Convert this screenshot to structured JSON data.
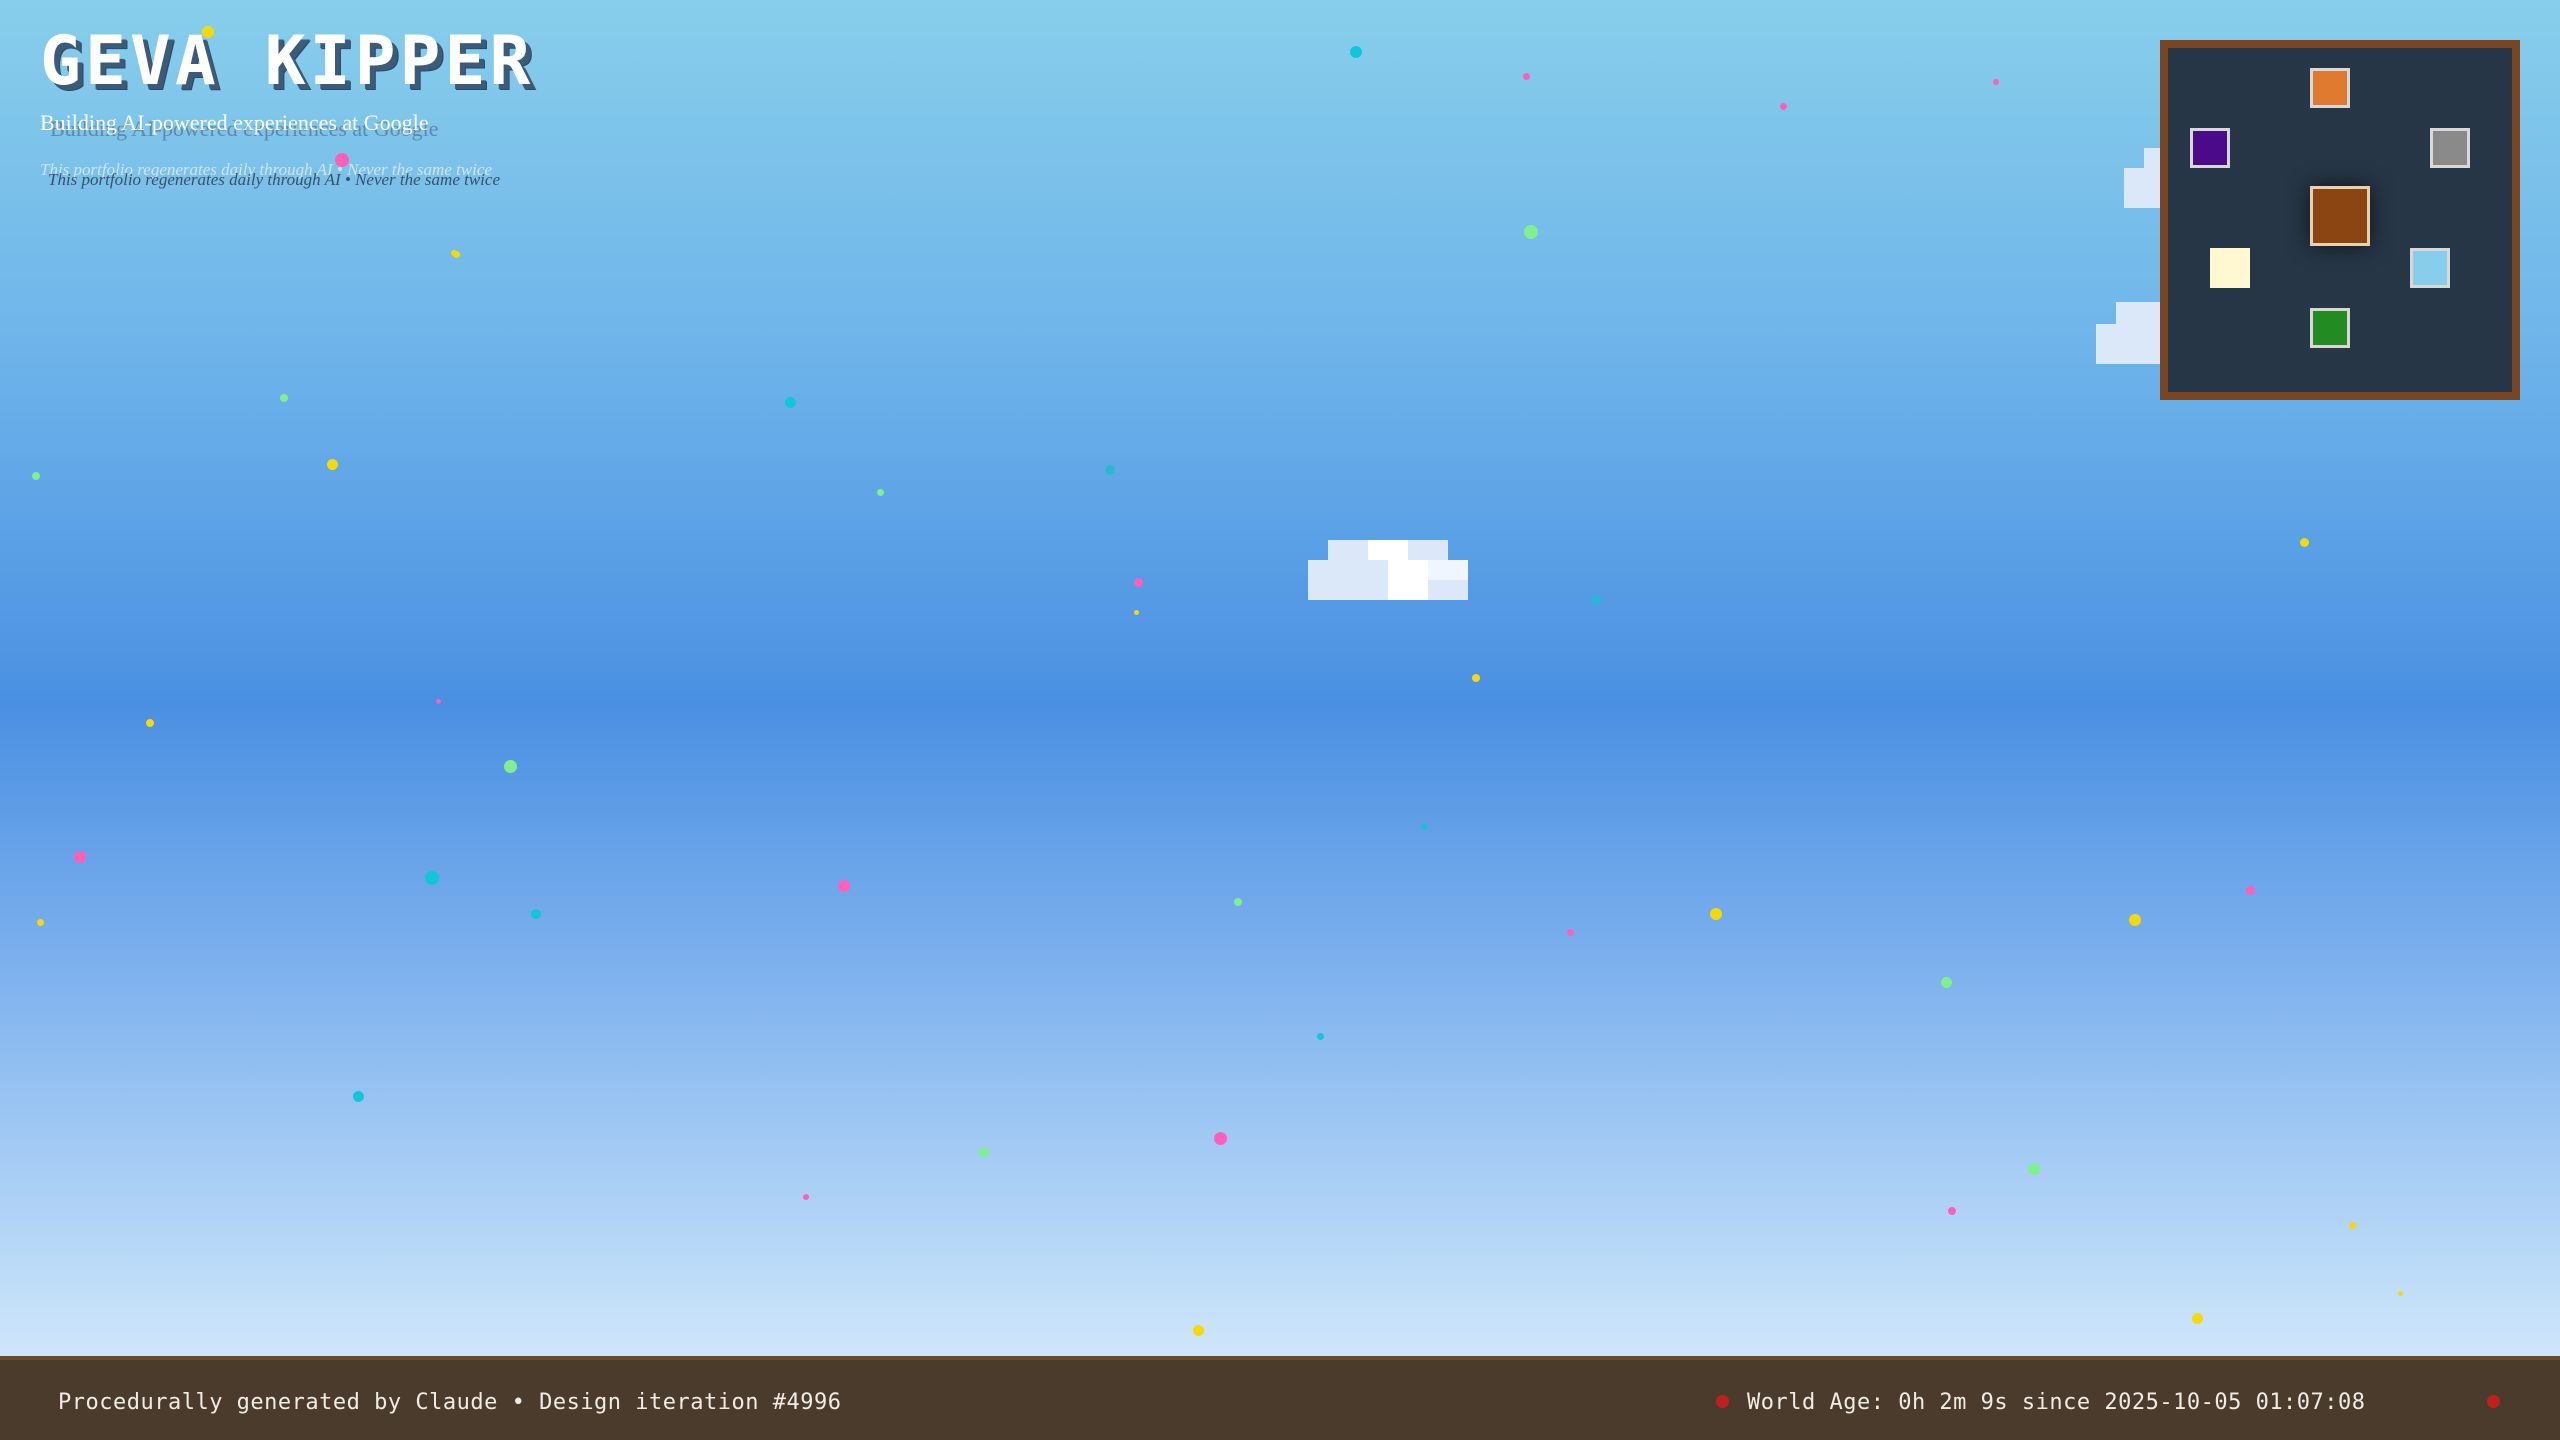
{
  "header": {
    "title": "GEVA KIPPER",
    "subtitle": "Building AI-powered experiences at Google",
    "tagline": "This portfolio regenerates daily through AI • Never the same twice"
  },
  "minimap": {
    "background": "#263646",
    "border": "#7a4522",
    "nodes": [
      {
        "name": "orange",
        "color": "#e07a2e"
      },
      {
        "name": "purple",
        "color": "#4b0a8a"
      },
      {
        "name": "gray",
        "color": "#8a8a8a"
      },
      {
        "name": "brown-center",
        "color": "#8b4513"
      },
      {
        "name": "cream",
        "color": "#fff8d0"
      },
      {
        "name": "light-blue",
        "color": "#87ceeb"
      },
      {
        "name": "green",
        "color": "#228b22"
      }
    ]
  },
  "footer": {
    "left_text": "Procedurally generated by Claude • Design iteration #4996",
    "right_text": "World Age: 0h 2m 9s since 2025-10-05 01:07:08"
  },
  "colors": {
    "sky_top": "#87ceeb",
    "sky_mid": "#4a90e2",
    "sky_bottom": "#cfe6fb",
    "footer_bg": "#4a3b2c",
    "footer_border": "#6b4a2a",
    "indicator": "#c0201d",
    "particles": [
      "#f5d90a",
      "#12c6d8",
      "#7ef08f",
      "#ff5fb8",
      "#2ab7d6"
    ]
  }
}
